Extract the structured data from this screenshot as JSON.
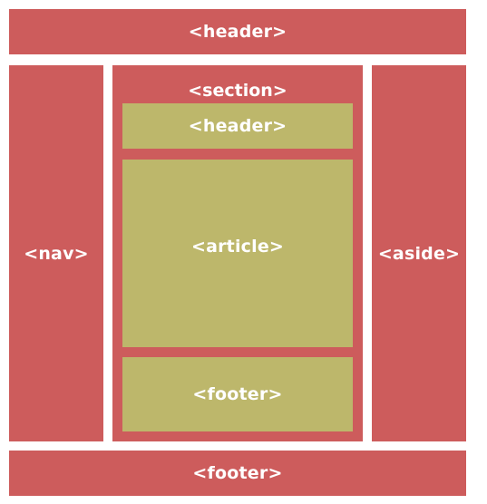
{
  "diagram": {
    "page_header": "<header>",
    "nav": "<nav>",
    "section": {
      "label": "<section>",
      "header": "<header>",
      "article": "<article>",
      "footer": "<footer>"
    },
    "aside": "<aside>",
    "page_footer": "<footer>"
  },
  "colors": {
    "outer_blocks": "#cd5c5c",
    "inner_blocks": "#bdb76b",
    "text": "#ffffff"
  }
}
